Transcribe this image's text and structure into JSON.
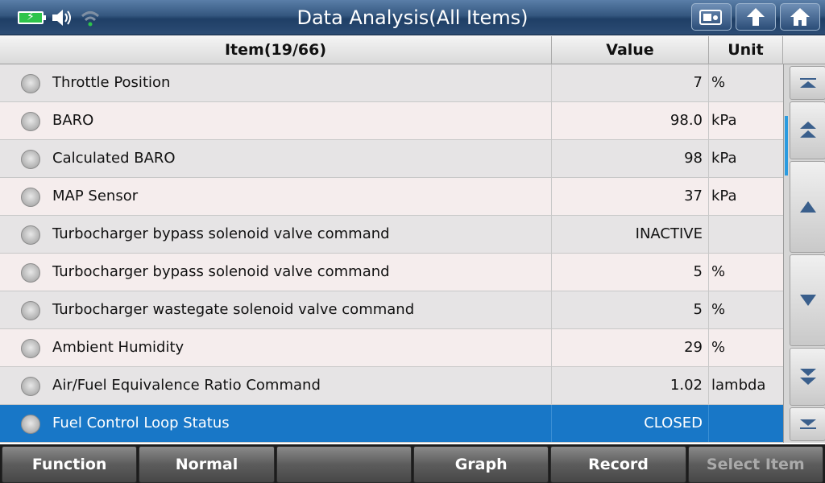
{
  "header": {
    "title": "Data Analysis(All Items)",
    "status_icons": [
      "battery-charging-icon",
      "speaker-icon",
      "wifi-icon"
    ],
    "buttons": [
      "screenshot-icon",
      "back-arrow-icon",
      "home-icon"
    ]
  },
  "table": {
    "columns": {
      "item": "Item(19/66)",
      "value": "Value",
      "unit": "Unit"
    },
    "rows": [
      {
        "label": "Throttle Position",
        "value": "7",
        "unit": "%"
      },
      {
        "label": "BARO",
        "value": "98.0",
        "unit": "kPa"
      },
      {
        "label": "Calculated BARO",
        "value": "98",
        "unit": "kPa"
      },
      {
        "label": "MAP Sensor",
        "value": "37",
        "unit": "kPa"
      },
      {
        "label": "Turbocharger bypass solenoid valve command",
        "value": "INACTIVE",
        "unit": ""
      },
      {
        "label": "Turbocharger bypass solenoid valve command",
        "value": "5",
        "unit": "%"
      },
      {
        "label": "Turbocharger wastegate solenoid valve command",
        "value": "5",
        "unit": "%"
      },
      {
        "label": "Ambient Humidity",
        "value": "29",
        "unit": "%"
      },
      {
        "label": "Air/Fuel Equivalence Ratio Command",
        "value": "1.02",
        "unit": "lambda"
      },
      {
        "label": "Fuel Control Loop Status",
        "value": "CLOSED",
        "unit": ""
      }
    ],
    "selected_index": 9
  },
  "scroll": {
    "buttons": [
      "scroll-top-icon",
      "page-up-icon",
      "line-up-icon",
      "line-down-icon",
      "page-down-icon",
      "scroll-bottom-icon"
    ]
  },
  "toolbar": {
    "function": "Function",
    "normal": "Normal",
    "empty": "",
    "graph": "Graph",
    "record": "Record",
    "select_item": "Select Item"
  },
  "colors": {
    "header_bg": "#2c4c74",
    "selected_row": "#1877c7",
    "row_odd": "#e6e4e5",
    "row_even": "#f5eded",
    "toolbar_bg": "#5c5c5c",
    "battery_green": "#2ec44b"
  }
}
